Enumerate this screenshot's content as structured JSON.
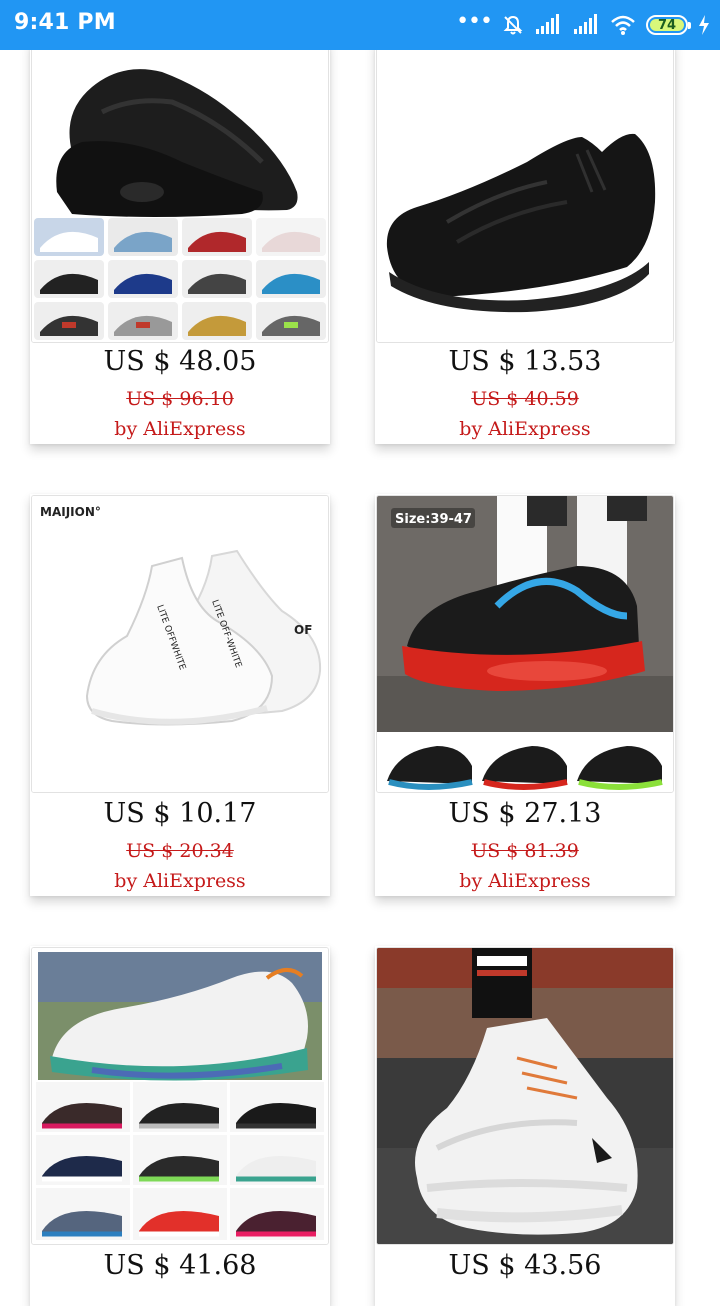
{
  "status_bar": {
    "time": "9:41 PM",
    "battery": "74"
  },
  "products": [
    {
      "price": "US $ 48.05",
      "old_price": "US $ 96.10",
      "seller": "by AliExpress",
      "image": "black-air-max-sneaker-with-color-grid"
    },
    {
      "price": "US $ 13.53",
      "old_price": "US $ 40.59",
      "seller": "by AliExpress",
      "image": "black-knit-sneaker"
    },
    {
      "price": "US $ 10.17",
      "old_price": "US $ 20.34",
      "seller": "by AliExpress",
      "image": "white-sneaker-pair",
      "brand": "MAIJION°"
    },
    {
      "price": "US $ 27.13",
      "old_price": "US $ 81.39",
      "seller": "by AliExpress",
      "image": "black-red-air-sneaker-on-feet",
      "size_tag": "Size:39-47"
    },
    {
      "price": "US $ 41.68",
      "image": "white-teal-sneaker-with-color-grid"
    },
    {
      "price": "US $ 43.56",
      "image": "white-chunky-sneaker-on-feet"
    }
  ]
}
